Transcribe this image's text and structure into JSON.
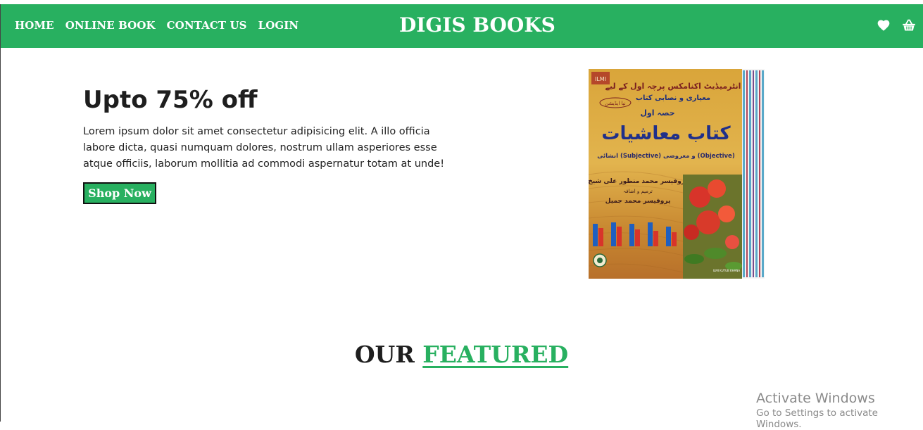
{
  "nav": {
    "links": [
      "HOME",
      "ONLINE BOOK",
      "CONTACT US",
      "LOGIN"
    ],
    "brand": "DIGIS BOOKS",
    "icons": [
      "heart-icon",
      "basket-icon"
    ]
  },
  "hero": {
    "title": "Upto 75% off",
    "text": "Lorem ipsum dolor sit amet consectetur adipisicing elit. A illo officia labore dicta, quasi numquam dolores, nostrum ullam asperiores esse atque officiis, laborum mollitia ad commodi aspernatur totam at unde!",
    "button_label": "Shop Now",
    "book_cover": {
      "top_line": "انٹرمیڈیٹ اکنامکس پرچہ اول کے لیے",
      "subtitle": "معیاری و نصابی کتاب",
      "part": "حصہ اول",
      "title": "کتاب معاشیات",
      "edition": "نیا ایڈیشن",
      "types": "انشائی (Subjective) و معروضی (Objective)",
      "author1": "پروفیسر محمد منظور علی شیخ",
      "author_note": "ترمیم و اضافہ",
      "author2": "پروفیسر محمد جمیل",
      "publisher": "ILMI KUTUB KHANA",
      "spine": "ILMI"
    }
  },
  "featured": {
    "word1": "OUR",
    "word2": "FEATURED"
  },
  "watermark": {
    "line1": "Activate Windows",
    "line2": "Go to Settings to activate Windows."
  },
  "colors": {
    "primary": "#28b060",
    "text": "#1e1e1e",
    "white": "#ffffff"
  }
}
